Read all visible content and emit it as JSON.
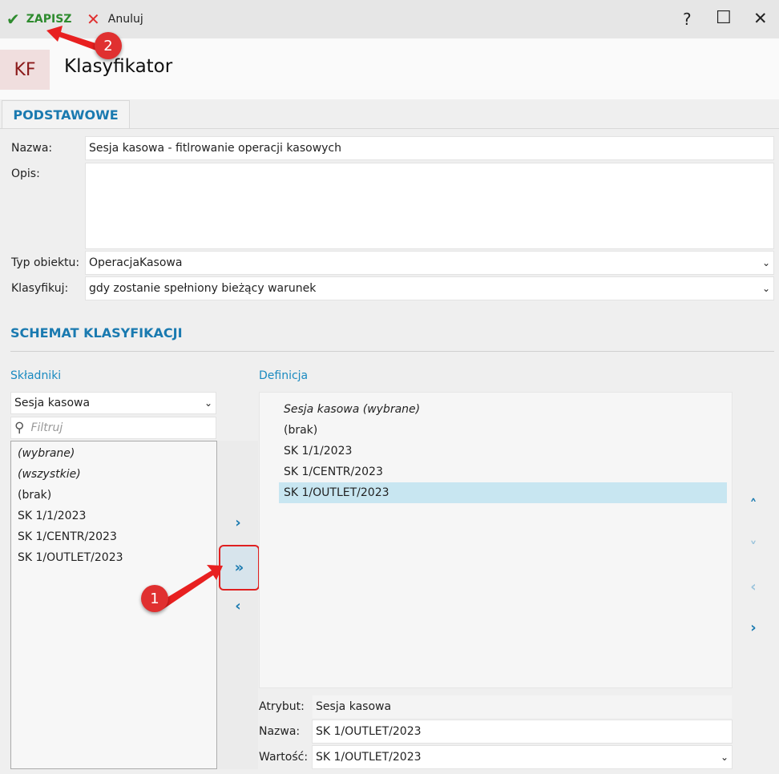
{
  "toolbar": {
    "save": "ZAPISZ",
    "cancel": "Anuluj",
    "help": "?",
    "maximize": "☐",
    "close": "✕"
  },
  "header": {
    "badge": "KF",
    "title": "Klasyfikator"
  },
  "tabs": [
    {
      "label": "PODSTAWOWE"
    }
  ],
  "form": {
    "name_label": "Nazwa:",
    "name_value": "Sesja kasowa - fitlrowanie operacji kasowych",
    "desc_label": "Opis:",
    "desc_value": "",
    "type_label": "Typ obiektu:",
    "type_value": "OperacjaKasowa",
    "classify_label": "Klasyfikuj:",
    "classify_value": "gdy zostanie spełniony bieżący warunek"
  },
  "schema": {
    "title": "SCHEMAT KLASYFIKACJI",
    "components_label": "Składniki",
    "components_select": "Sesja kasowa",
    "filter_placeholder": "Filtruj",
    "components": [
      {
        "label": "(wybrane)",
        "italic": true
      },
      {
        "label": "(wszystkie)",
        "italic": true
      },
      {
        "label": "(brak)"
      },
      {
        "label": "SK 1/1/2023"
      },
      {
        "label": "SK 1/CENTR/2023"
      },
      {
        "label": "SK 1/OUTLET/2023"
      }
    ],
    "definition_label": "Definicja",
    "definition": [
      {
        "label": "Sesja kasowa (wybrane)",
        "italic": true
      },
      {
        "label": "(brak)"
      },
      {
        "label": "SK 1/1/2023"
      },
      {
        "label": "SK 1/CENTR/2023"
      },
      {
        "label": "SK 1/OUTLET/2023",
        "selected": true
      }
    ],
    "attr_label": "Atrybut:",
    "attr_value": "Sesja kasowa",
    "name_label": "Nazwa:",
    "name_value": "SK 1/OUTLET/2023",
    "value_label": "Wartość:",
    "value_value": "SK 1/OUTLET/2023"
  },
  "annotations": [
    {
      "label": "1"
    },
    {
      "label": "2"
    }
  ],
  "colors": {
    "accent": "#1a7ab0",
    "save": "#2e8b2e",
    "cancel": "#e03030",
    "selected": "#c8e6f1"
  }
}
